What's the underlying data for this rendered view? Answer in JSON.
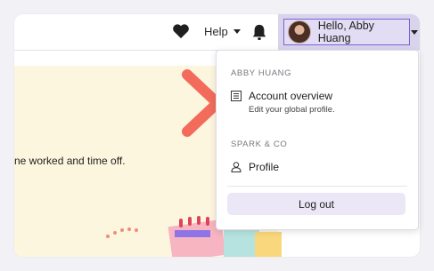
{
  "topbar": {
    "favorites_icon": "heart-icon",
    "help_label": "Help",
    "notifications_icon": "bell-icon",
    "user_greeting": "Hello, Abby Huang"
  },
  "banner": {
    "text": "ne worked and time off."
  },
  "menu": {
    "account_section": "ABBY HUANG",
    "account_overview": {
      "title": "Account overview",
      "subtitle": "Edit your global profile.",
      "icon": "list-icon"
    },
    "company_section": "SPARK & CO",
    "profile": {
      "title": "Profile",
      "icon": "person-icon"
    },
    "logout_label": "Log out"
  },
  "colors": {
    "user_button_bg": "#d9d4ec",
    "banner_bg": "#fdf6df",
    "arrow": "#f26b5b",
    "logout_bg": "#ebe7f6"
  }
}
